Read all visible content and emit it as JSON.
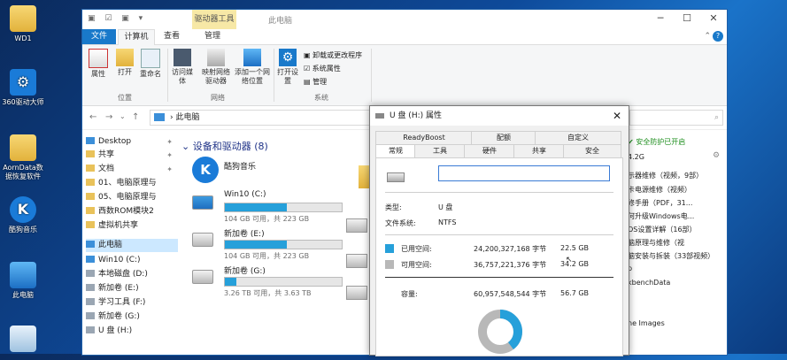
{
  "desktop": {
    "icons": [
      {
        "label": "WD1"
      },
      {
        "label": "360驱动大师"
      },
      {
        "label": "AornData数据恢复软件"
      },
      {
        "label": "酷狗音乐"
      },
      {
        "label": "此电脑"
      },
      {
        "label": ""
      }
    ]
  },
  "explorer": {
    "context_tab": "驱动器工具",
    "title": "此电脑",
    "ribbon_tabs": {
      "file": "文件",
      "computer": "计算机",
      "view": "查看",
      "manage": "管理"
    },
    "ribbon": {
      "properties": "属性",
      "open": "打开",
      "rename": "重命名",
      "access_media": "访问媒体",
      "map_drive": "映射网络驱动器",
      "add_location": "添加一个网络位置",
      "open_settings": "打开设置",
      "uninstall": "卸载或更改程序",
      "sys_props": "系统属性",
      "manage": "管理",
      "group_location": "位置",
      "group_network": "网络",
      "group_system": "系统"
    },
    "address": "此电脑",
    "nav": {
      "desktop": "Desktop",
      "share": "共享",
      "docs": "文档",
      "f1": "01、电脑原理与",
      "f2": "05、电脑原理与",
      "f3": "西数ROM模块2",
      "f4": "虚拟机共享",
      "thispc": "此电脑",
      "c": "Win10 (C:)",
      "d": "本地磁盘 (D:)",
      "e": "新加卷 (E:)",
      "f": "学习工具 (F:)",
      "g": "新加卷 (G:)",
      "h": "U 盘 (H:)"
    },
    "section_title": "设备和驱动器 (8)",
    "kugou": "酷狗音乐",
    "drives": [
      {
        "name": "Win10 (C:)",
        "free": "104 GB 可用，共 223 GB",
        "used_fraction": 0.53
      },
      {
        "name": "新加卷 (E:)",
        "free": "104 GB 可用，共 223 GB",
        "used_fraction": 0.53
      },
      {
        "name": "新加卷 (G:)",
        "free": "3.26 TB 可用，共 3.63 TB",
        "used_fraction": 0.1
      }
    ],
    "right_pane": {
      "security": "安全防护已开启",
      "size": "4.2G",
      "lines": [
        "示器维修（视频，9部）",
        "卡电源维修（视频）",
        "修手册（PDF，31...",
        "何升级Windows电...",
        "OS设置详解（16部）",
        "脑原理与维修（视",
        "脑安装与拆装（33部视频）",
        "p",
        "kbenchData",
        "ne Images"
      ]
    }
  },
  "dialog": {
    "title": "U 盘 (H:) 属性",
    "tabs_row1": [
      "ReadyBoost",
      "配额",
      "自定义"
    ],
    "tabs_row2": [
      "常规",
      "工具",
      "硬件",
      "共享",
      "安全"
    ],
    "name_value": "",
    "type_label": "类型:",
    "type_value": "U 盘",
    "fs_label": "文件系统:",
    "fs_value": "NTFS",
    "used_label": "已用空间:",
    "used_bytes": "24,200,327,168 字节",
    "used_gb": "22.5 GB",
    "free_label": "可用空间:",
    "free_bytes": "36,757,221,376 字节",
    "free_gb": "34.2 GB",
    "cap_label": "容量:",
    "cap_bytes": "60,957,548,544 字节",
    "cap_gb": "56.7 GB",
    "used_fraction": 0.397,
    "colors": {
      "used": "#26a0da",
      "free": "#b8b8b8"
    }
  }
}
